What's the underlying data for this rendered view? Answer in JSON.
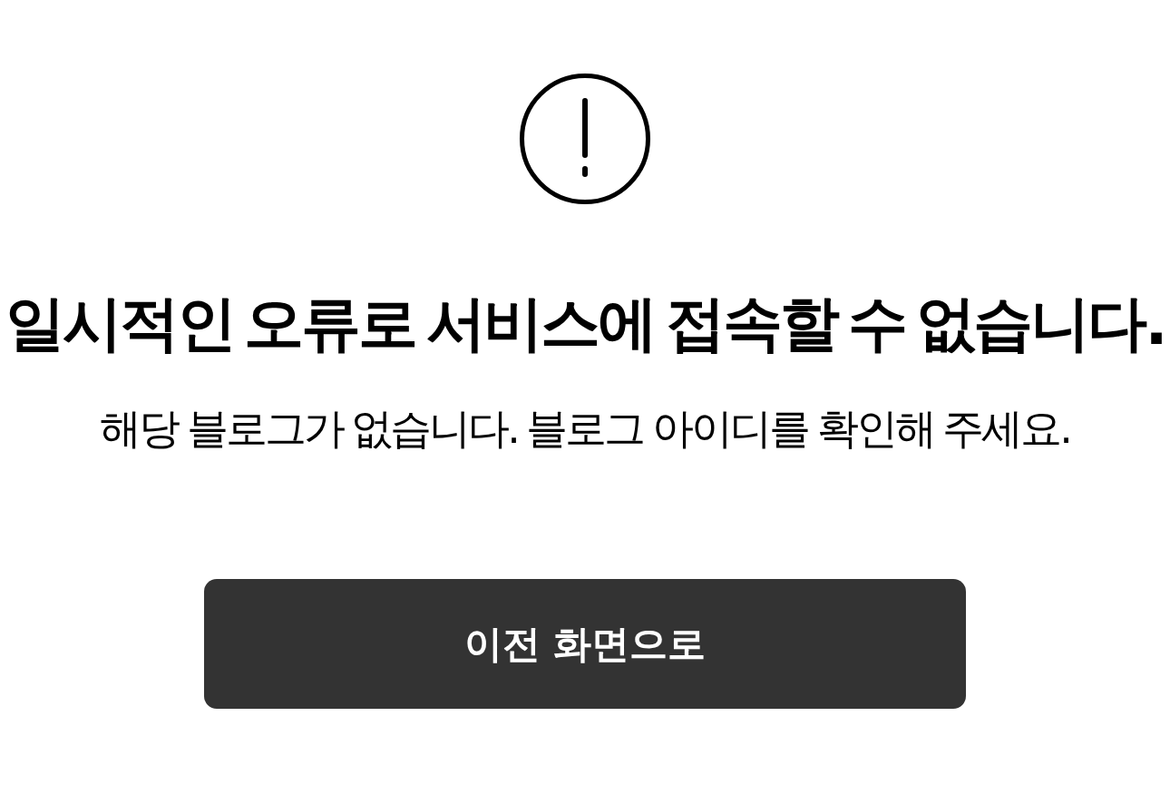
{
  "title": "일시적인 오류로 서비스에 접속할 수 없습니다.",
  "message": "해당 블로그가 없습니다. 블로그 아이디를 확인해 주세요.",
  "button": {
    "label": "이전 화면으로"
  }
}
